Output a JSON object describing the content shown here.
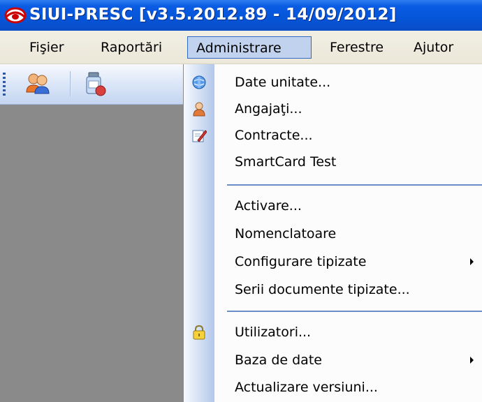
{
  "window": {
    "title": "SIUI-PRESC [v3.5.2012.89 - 14/09/2012]"
  },
  "menubar": {
    "items": [
      {
        "label": "Fişier"
      },
      {
        "label": "Raportări"
      },
      {
        "label": "Administrare"
      },
      {
        "label": "Ferestre"
      },
      {
        "label": "Ajutor"
      }
    ],
    "active": "Administrare"
  },
  "toolbar": {
    "buttons": [
      {
        "icon": "users-icon"
      },
      {
        "icon": "medicine-bottle-icon"
      }
    ]
  },
  "dropdown": {
    "items": [
      {
        "label": "Date unitate...",
        "icon": "unit-data-icon"
      },
      {
        "label": "Angajaţi...",
        "icon": "employee-icon"
      },
      {
        "label": "Contracte...",
        "icon": "contract-edit-icon"
      },
      {
        "label": "SmartCard Test"
      },
      {
        "label": "Activare..."
      },
      {
        "label": "Nomenclatoare"
      },
      {
        "label": "Configurare tipizate",
        "submenu": true
      },
      {
        "label": "Serii documente tipizate..."
      },
      {
        "label": "Utilizatori...",
        "icon": "lock-icon"
      },
      {
        "label": "Baza de date",
        "submenu": true
      },
      {
        "label": "Actualizare versiuni..."
      }
    ]
  },
  "colors": {
    "titlebar": "#0655d8",
    "menubar": "#ebe8d9",
    "menu_highlight": "#c1d2ee",
    "workspace": "#8a8a8a",
    "separator": "#6a8cc8"
  }
}
